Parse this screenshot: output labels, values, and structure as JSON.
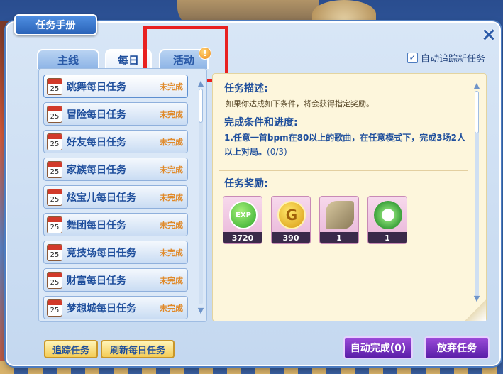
{
  "window": {
    "title": "任务手册",
    "close_icon": "×"
  },
  "tabs": [
    {
      "label": "主线",
      "active": false
    },
    {
      "label": "每日",
      "active": true
    },
    {
      "label": "活动",
      "active": false,
      "alert": "!"
    }
  ],
  "auto_track": {
    "checked": true,
    "check_glyph": "✓",
    "label": "自动追踪新任务"
  },
  "task_list": [
    {
      "name": "跳舞每日任务",
      "status": "未完成",
      "selected": true
    },
    {
      "name": "冒险每日任务",
      "status": "未完成"
    },
    {
      "name": "好友每日任务",
      "status": "未完成"
    },
    {
      "name": "家族每日任务",
      "status": "未完成"
    },
    {
      "name": "炫宝儿每日任务",
      "status": "未完成"
    },
    {
      "name": "舞团每日任务",
      "status": "未完成"
    },
    {
      "name": "竞技场每日任务",
      "status": "未完成"
    },
    {
      "name": "财富每日任务",
      "status": "未完成"
    },
    {
      "name": "梦想城每日任务",
      "status": "未完成"
    }
  ],
  "calendar_icon_text": "25",
  "detail": {
    "desc_title": "任务描述:",
    "desc_text": "如果你达成如下条件，将会获得指定奖励。",
    "cond_title": "完成条件和进度:",
    "cond_text": "1.任意一首bpm在80以上的歌曲，在任意模式下，完成3场2人以上对局。",
    "cond_progress": "(0/3)",
    "reward_title": "任务奖励:"
  },
  "rewards": [
    {
      "icon": "exp-icon",
      "label": "EXP",
      "count": "3720"
    },
    {
      "icon": "gold-coin-icon",
      "label": "G",
      "count": "390"
    },
    {
      "icon": "cloth-icon",
      "label": "",
      "count": "1"
    },
    {
      "icon": "cloud-leaf-icon",
      "label": "",
      "count": "1"
    }
  ],
  "buttons": {
    "track": "追踪任务",
    "refresh": "刷新每日任务",
    "auto_complete": "自动完成(0)",
    "abandon": "放弃任务"
  },
  "scroll_arrows": {
    "up": "▲",
    "down": "▼"
  }
}
